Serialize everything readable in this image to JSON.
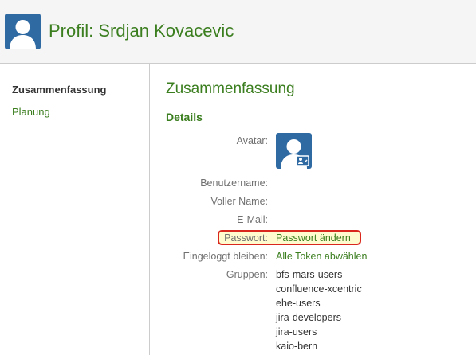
{
  "header": {
    "title": "Profil: Srdjan Kovacevic",
    "avatar_icon": "user-avatar-icon"
  },
  "sidebar": {
    "items": [
      {
        "label": "Zusammenfassung",
        "active": true
      },
      {
        "label": "Planung",
        "active": false
      }
    ]
  },
  "main": {
    "title": "Zusammenfassung",
    "section_title": "Details",
    "fields": {
      "avatar_label": "Avatar:",
      "username_label": "Benutzername:",
      "fullname_label": "Voller Name:",
      "email_label": "E-Mail:",
      "password_label": "Passwort:",
      "password_value": "Passwort ändern",
      "remember_label": "Eingeloggt bleiben:",
      "remember_value": "Alle Token abwählen",
      "groups_label": "Gruppen:"
    },
    "groups": [
      "bfs-mars-users",
      "confluence-xcentric",
      "ehe-users",
      "jira-developers",
      "jira-users",
      "kaio-bern"
    ]
  },
  "colors": {
    "accent_green": "#3b7e1f",
    "avatar_blue": "#2f6aa3",
    "highlight_bg": "#fffbcf",
    "highlight_border": "#d9271d"
  }
}
